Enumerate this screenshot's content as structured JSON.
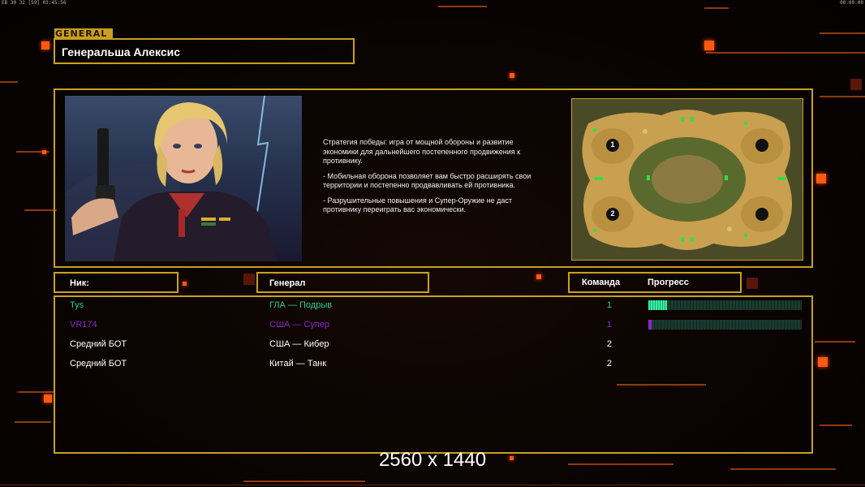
{
  "hud": {
    "left": "ЕВ 30 32 [59] 03:45:56",
    "right": "00:00:00"
  },
  "general": {
    "tag": "GENERAL",
    "name": "Генеральша Алексис"
  },
  "description": [
    "Стратегия победы: игра от мощной обороны и развитие\n экономики для дальнейшего постепенного продвижения к\n противнику.",
    "- Мобильная оборона позволяет вам быстро расширять свои\n территории и постепенно продвавливать ей противника.",
    "- Разрушительные повышения и Супер-Оружие не даст\n противнику переиграть вас экономически."
  ],
  "minimap": {
    "start_labels": [
      "1",
      "2"
    ]
  },
  "columns": {
    "nick": "Ник:",
    "general": "Генерал",
    "team": "Команда",
    "progress": "Прогресс"
  },
  "players": [
    {
      "nick": "Tys",
      "general": "ГЛА — Подрыв",
      "team": "1",
      "color": "#2ad08a",
      "progress": 0.12
    },
    {
      "nick": "VR174",
      "general": "США — Супер",
      "team": "1",
      "color": "#8a28c8",
      "progress": 0.02
    },
    {
      "nick": "Средний БОТ",
      "general": "США — Кибер",
      "team": "2",
      "color": "#ffffff",
      "progress": null
    },
    {
      "nick": "Средний БОТ",
      "general": "Китай — Танк",
      "team": "2",
      "color": "#ffffff",
      "progress": null
    }
  ],
  "resolution_text": "2560 x 1440",
  "colors": {
    "frame": "#c8a01e",
    "accent": "#ff5a10",
    "progress": "#3af0a0"
  }
}
